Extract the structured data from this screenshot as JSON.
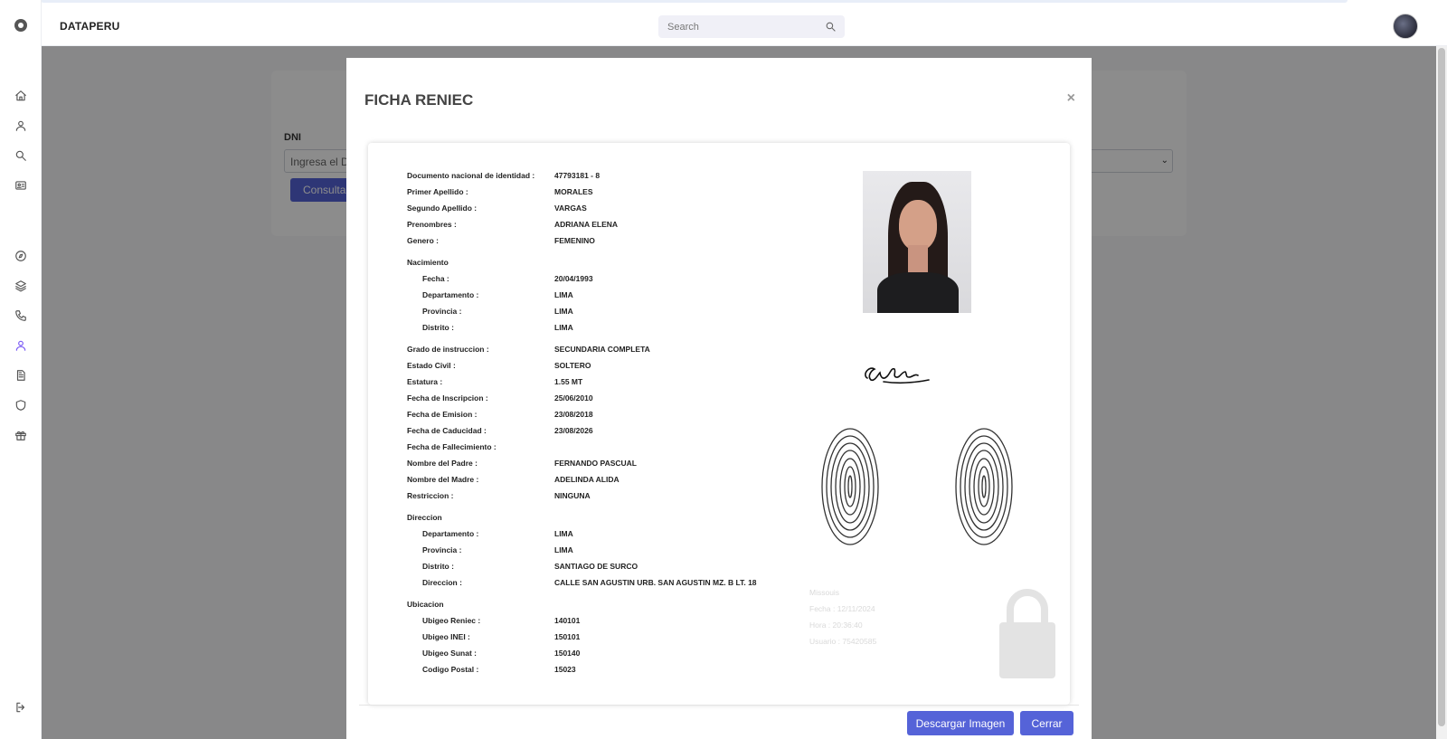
{
  "app": {
    "brand": "DATAPERU",
    "search_placeholder": "Search"
  },
  "sidebar": {
    "items": [
      {
        "icon": "home-icon"
      },
      {
        "icon": "user-icon"
      },
      {
        "icon": "search-icon"
      },
      {
        "icon": "id-card-icon"
      },
      {
        "icon": "compass-icon"
      },
      {
        "icon": "layers-icon"
      },
      {
        "icon": "phone-icon"
      },
      {
        "icon": "user-active-icon",
        "active": true
      },
      {
        "icon": "document-icon"
      },
      {
        "icon": "shield-icon"
      },
      {
        "icon": "gift-icon"
      }
    ],
    "logout_icon": "logout-icon",
    "active_color": "#7a5af5"
  },
  "page": {
    "dni_label": "DNI",
    "dni_placeholder": "Ingresa el DNI",
    "consultar_label": "Consultar"
  },
  "modal": {
    "title": "FICHA RENIEC",
    "close_glyph": "×",
    "download_label": "Descargar Imagen",
    "close_label": "Cerrar",
    "accent": "#5563d8"
  },
  "ficha": {
    "rows": [
      {
        "label": "Documento nacional de identidad :",
        "value": "47793181 - 8"
      },
      {
        "label": "Primer Apellido :",
        "value": "MORALES"
      },
      {
        "label": "Segundo Apellido :",
        "value": "VARGAS"
      },
      {
        "label": "Prenombres :",
        "value": "ADRIANA ELENA"
      },
      {
        "label": "Genero :",
        "value": "FEMENINO"
      },
      {
        "label": "Nacimiento",
        "value": ""
      },
      {
        "label": "Fecha :",
        "value": "20/04/1993"
      },
      {
        "label": "Departamento :",
        "value": "LIMA"
      },
      {
        "label": "Provincia :",
        "value": "LIMA"
      },
      {
        "label": "Distrito :",
        "value": "LIMA"
      },
      {
        "label": "Grado de instruccion :",
        "value": "SECUNDARIA COMPLETA"
      },
      {
        "label": "Estado Civil :",
        "value": "SOLTERO"
      },
      {
        "label": "Estatura :",
        "value": "1.55 MT"
      },
      {
        "label": "Fecha de Inscripcion :",
        "value": "25/06/2010"
      },
      {
        "label": "Fecha de Emision :",
        "value": "23/08/2018"
      },
      {
        "label": "Fecha de Caducidad :",
        "value": "23/08/2026"
      },
      {
        "label": "Fecha de Fallecimiento :",
        "value": ""
      },
      {
        "label": "Nombre del Padre :",
        "value": "FERNANDO PASCUAL"
      },
      {
        "label": "Nombre del Madre :",
        "value": "ADELINDA ALIDA"
      },
      {
        "label": "Restriccion :",
        "value": "NINGUNA"
      },
      {
        "label": "Direccion",
        "value": ""
      },
      {
        "label": "Departamento :",
        "value": "LIMA"
      },
      {
        "label": "Provincia :",
        "value": "LIMA"
      },
      {
        "label": "Distrito :",
        "value": "SANTIAGO DE SURCO"
      },
      {
        "label": "Direccion :",
        "value": "CALLE SAN AGUSTIN URB. SAN AGUSTIN MZ. B LT. 18"
      },
      {
        "label": "Ubicacion",
        "value": ""
      },
      {
        "label": "Ubigeo Reniec :",
        "value": "140101"
      },
      {
        "label": "Ubigeo INEI :",
        "value": "150101"
      },
      {
        "label": "Ubigeo Sunat :",
        "value": "150140"
      },
      {
        "label": "Codigo Postal :",
        "value": "15023"
      }
    ],
    "watermark": {
      "line1": "Missouis",
      "line2": "Fecha  :  12/11/2024",
      "line3": "Hora  :  20:36:40",
      "line4": "Usuario  :  75420585"
    }
  }
}
